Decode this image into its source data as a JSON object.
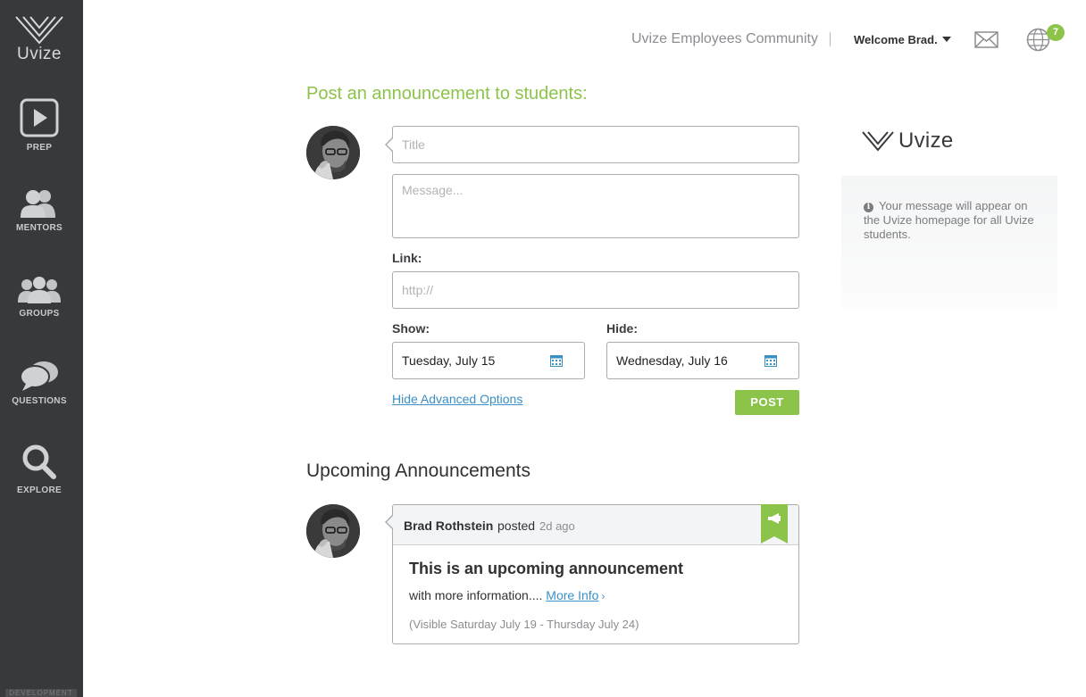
{
  "sidebar": {
    "brand": "Uvize",
    "items": [
      {
        "label": "PREP",
        "icon": "play-icon"
      },
      {
        "label": "MENTORS",
        "icon": "mentors-icon"
      },
      {
        "label": "GROUPS",
        "icon": "groups-icon"
      },
      {
        "label": "QUESTIONS",
        "icon": "questions-icon"
      },
      {
        "label": "EXPLORE",
        "icon": "search-icon"
      }
    ],
    "env_label": "DEVELOPMENT"
  },
  "header": {
    "community": "Uvize Employees Community",
    "welcome": "Welcome Brad.",
    "mail_icon": "mail-icon",
    "globe_icon": "globe-icon",
    "notification_count": "7"
  },
  "form": {
    "heading": "Post an announcement to students:",
    "title_placeholder": "Title",
    "message_placeholder": "Message...",
    "link_label": "Link:",
    "link_placeholder": "http://",
    "show_label": "Show:",
    "show_value": "Tuesday, July 15",
    "hide_label": "Hide:",
    "hide_value": "Wednesday, July 16",
    "advanced_link": "Hide Advanced Options",
    "post_button": "POST"
  },
  "info": {
    "logo": "Uvize",
    "message": "Your message will appear on the Uvize homepage for all Uvize students."
  },
  "upcoming": {
    "heading": "Upcoming Announcements",
    "items": [
      {
        "author": "Brad Rothstein",
        "posted": "posted",
        "ago": "2d ago",
        "title": "This is an upcoming announcement",
        "body": "with more information....",
        "more_link": "More Info",
        "more_chevron": "›",
        "visible": "(Visible Saturday July 19 - Thursday July 24)"
      }
    ]
  },
  "colors": {
    "accent": "#8cc44a",
    "sidebar": "#37393c",
    "link": "#3a8fc4"
  }
}
